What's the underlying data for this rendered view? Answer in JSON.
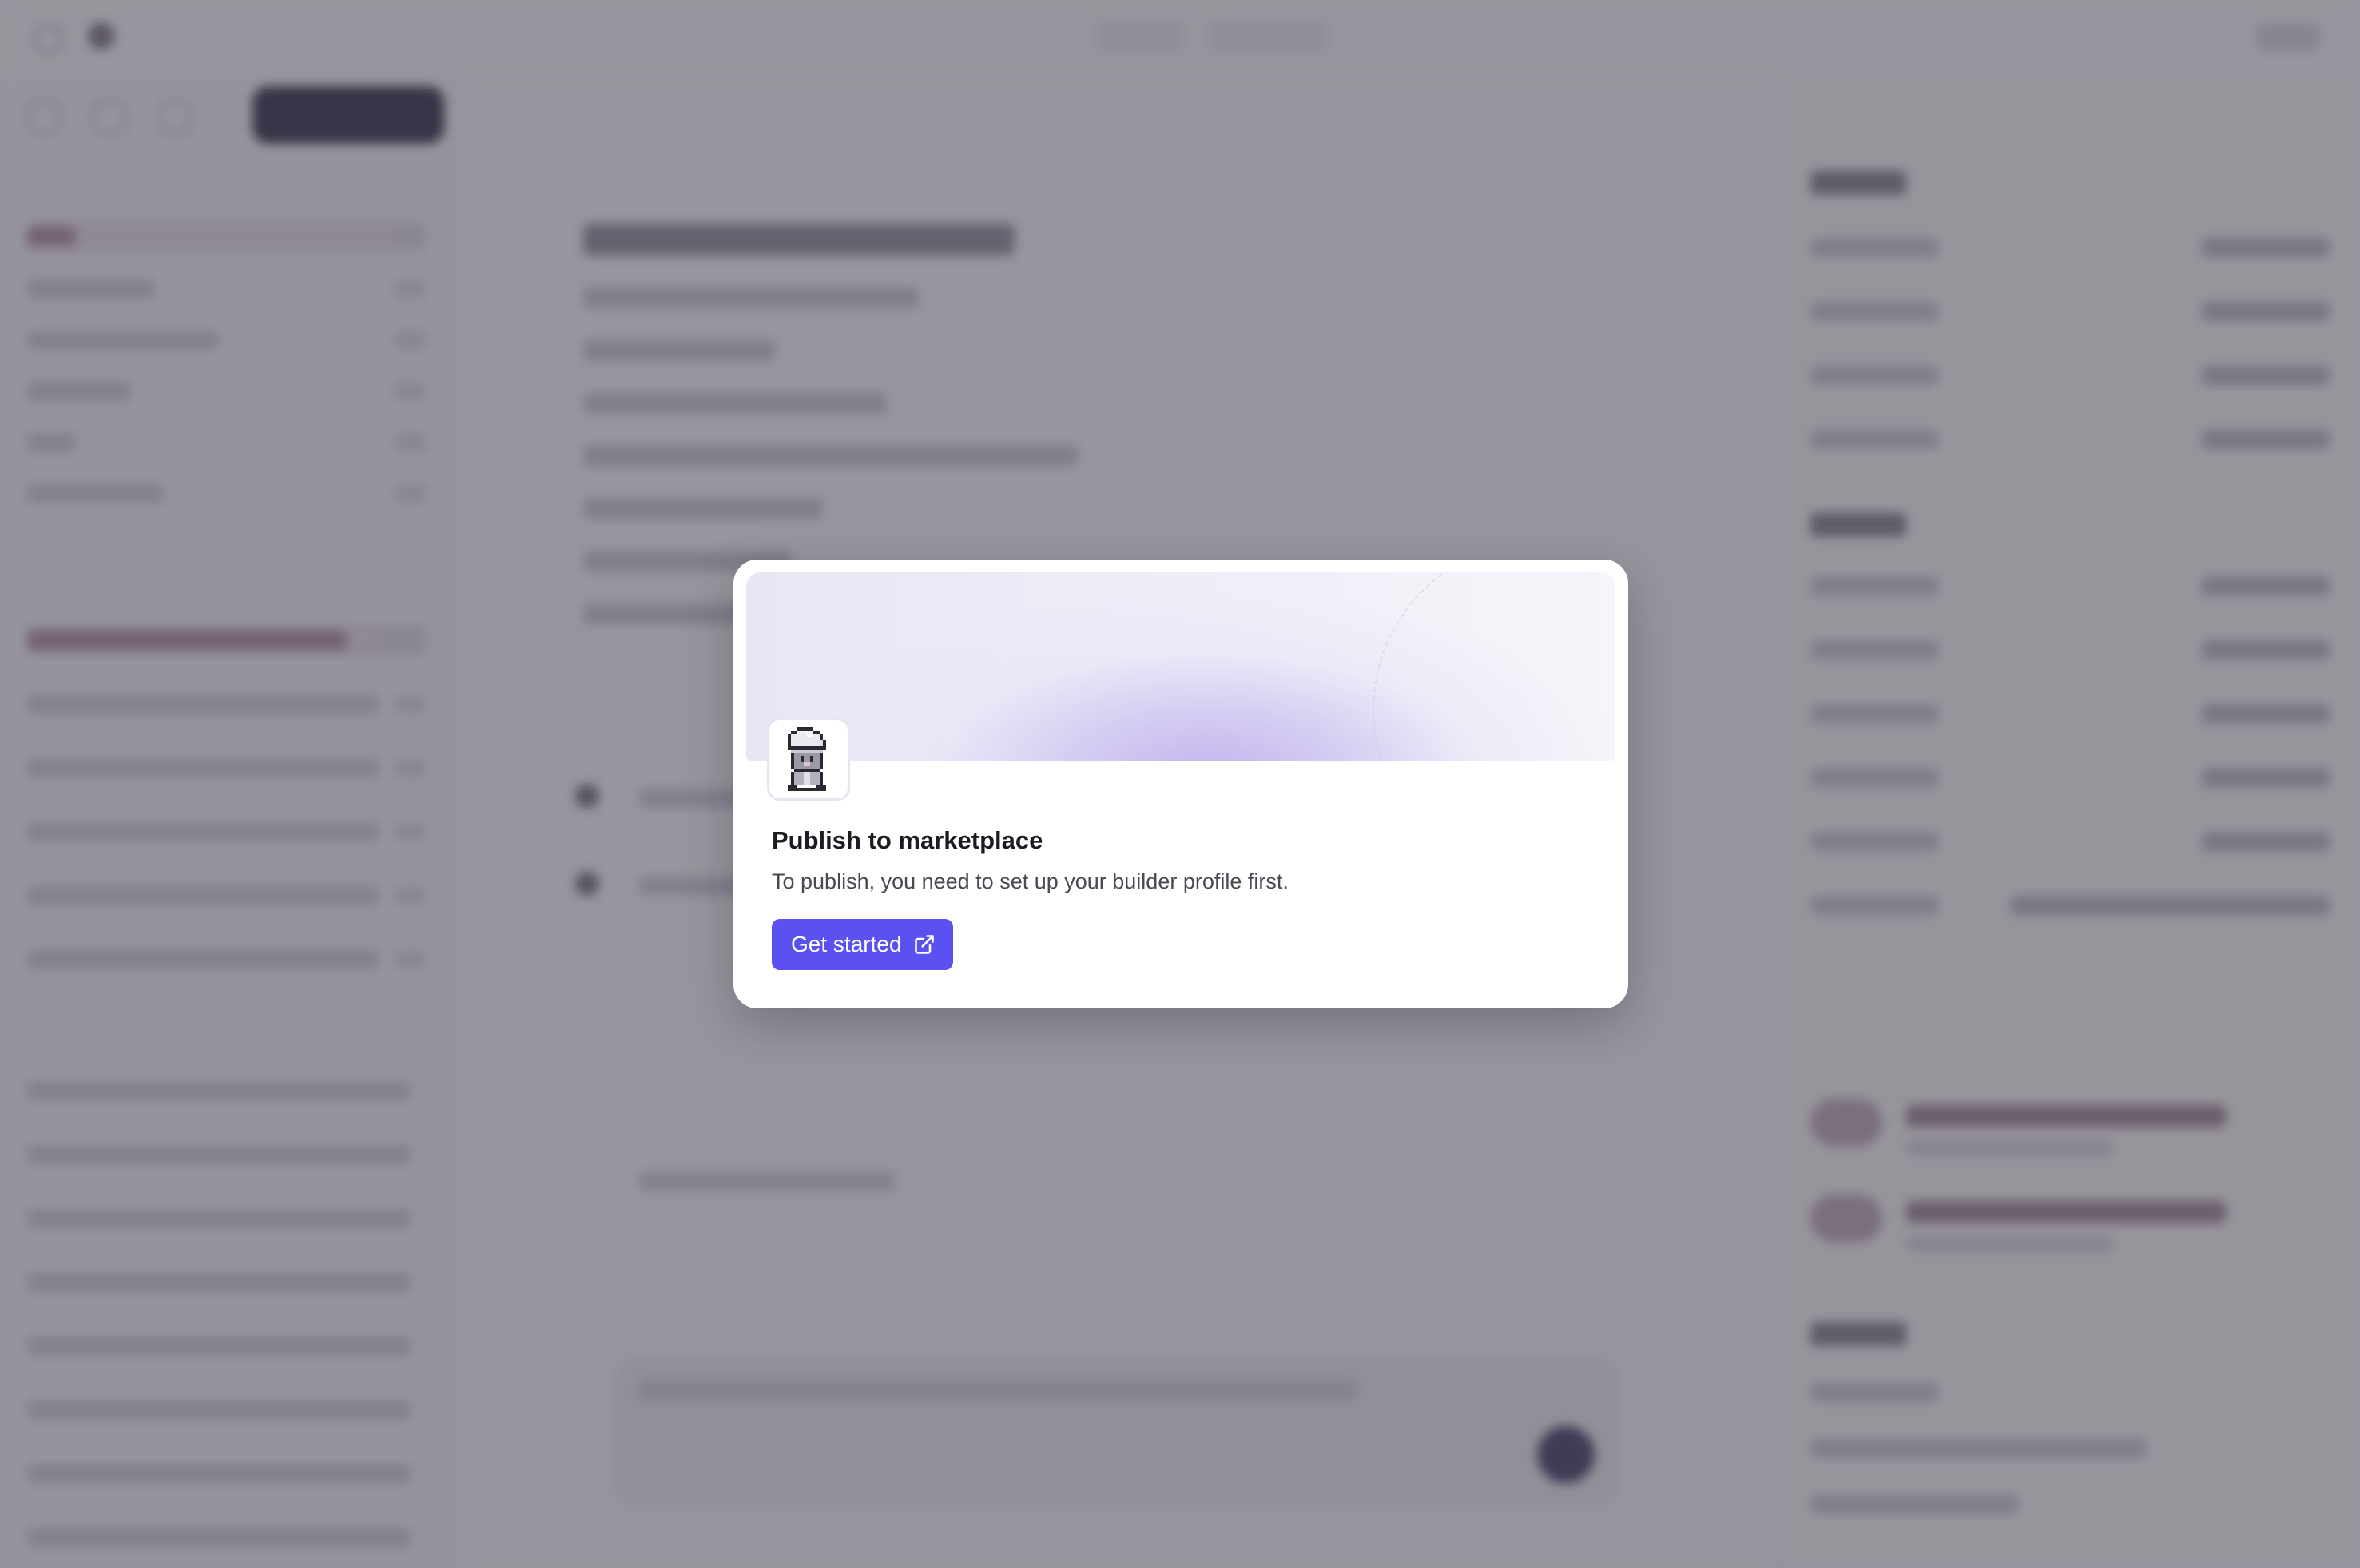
{
  "modal": {
    "title": "Publish to marketplace",
    "body": "To publish, you need to set up your builder profile first.",
    "cta_label": "Get started",
    "cta_icon": "external-link-icon",
    "avatar_icon": "pixel-wizard-avatar-icon"
  },
  "colors": {
    "accent": "#5b50f0",
    "scrim": "#46424e",
    "modal_bg": "#ffffff",
    "banner_glow": "#c4b2ee"
  }
}
